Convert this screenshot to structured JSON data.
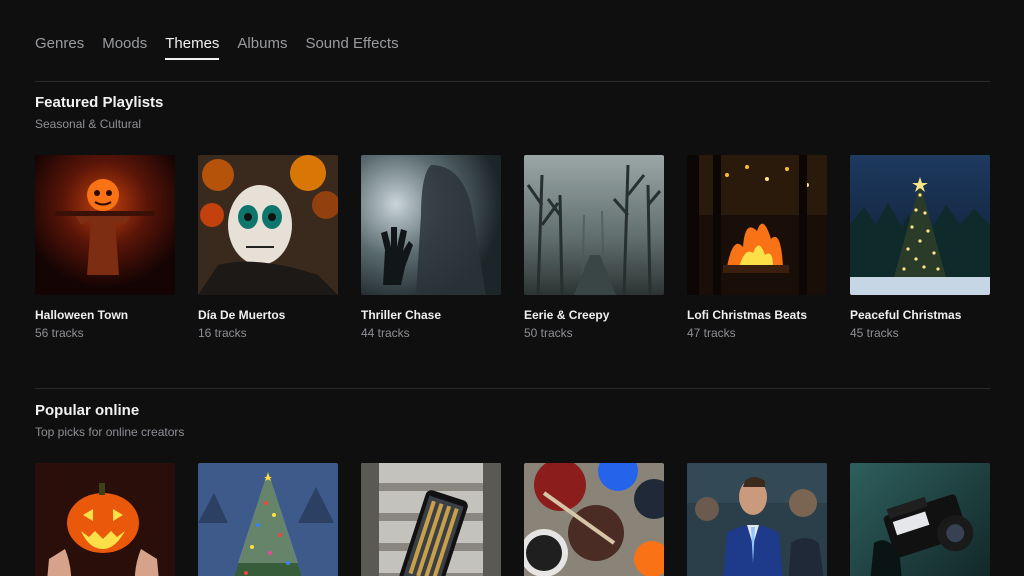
{
  "tabs": [
    {
      "label": "Genres",
      "active": false
    },
    {
      "label": "Moods",
      "active": false
    },
    {
      "label": "Themes",
      "active": true
    },
    {
      "label": "Albums",
      "active": false
    },
    {
      "label": "Sound Effects",
      "active": false
    }
  ],
  "featured": {
    "title": "Featured Playlists",
    "subtitle": "Seasonal & Cultural",
    "items": [
      {
        "title": "Halloween Town",
        "count": "56 tracks",
        "art": "scarecrow-image"
      },
      {
        "title": "Día De Muertos",
        "count": "16 tracks",
        "art": "sugar-skull-image"
      },
      {
        "title": "Thriller Chase",
        "count": "44 tracks",
        "art": "shadow-hand-image"
      },
      {
        "title": "Eerie & Creepy",
        "count": "50 tracks",
        "art": "foggy-forest-image"
      },
      {
        "title": "Lofi Christmas Beats",
        "count": "47 tracks",
        "art": "fireplace-image"
      },
      {
        "title": "Peaceful Christmas",
        "count": "45 tracks",
        "art": "christmas-tree-night-image"
      }
    ]
  },
  "popular": {
    "title": "Popular online",
    "subtitle": "Top picks for online creators",
    "items": [
      {
        "art": "jack-o-lantern-image"
      },
      {
        "art": "snowy-christmas-tree-image"
      },
      {
        "art": "smartphone-image"
      },
      {
        "art": "paint-cups-image"
      },
      {
        "art": "press-interview-image"
      },
      {
        "art": "video-camera-image"
      }
    ]
  },
  "colors": {
    "background": "#0f0f10",
    "tab_active": "#f2f2f3",
    "tab_inactive": "#9a9b9f",
    "muted_text": "#8f9095",
    "divider": "#2a2b2e"
  }
}
